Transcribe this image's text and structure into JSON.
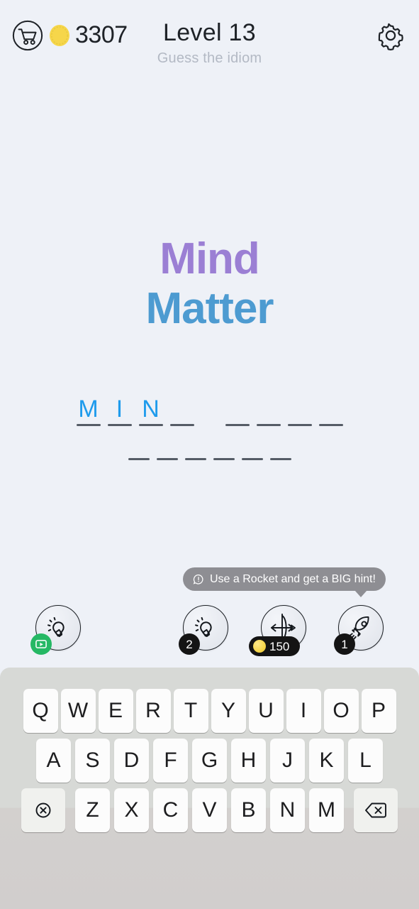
{
  "topbar": {
    "cart_icon": "shopping-cart-icon",
    "coin_icon": "coin-icon",
    "coin_count": "3307",
    "level_title": "Level 13",
    "level_subtitle": "Guess the idiom",
    "settings_icon": "gear-icon"
  },
  "rebus": {
    "line1": "Mind",
    "line2": "Matter",
    "line1_color": "#9b7fd4",
    "line2_color": "#4d9bd1"
  },
  "answer": {
    "row1": [
      {
        "word_index": 0,
        "letters": [
          "M",
          "I",
          "N",
          ""
        ]
      },
      {
        "word_index": 1,
        "letters": [
          "",
          "",
          "",
          ""
        ]
      }
    ],
    "row2": [
      {
        "word_index": 2,
        "letters": [
          "",
          "",
          "",
          "",
          "",
          ""
        ]
      }
    ],
    "filled_color": "#1e9bec"
  },
  "tooltip": {
    "icon": "exclamation-bubble-icon",
    "text": "Use a Rocket and get a BIG hint!"
  },
  "hints": [
    {
      "id": "hint-bulb-video",
      "icon": "lightbulb-icon",
      "badge_type": "video",
      "badge_icon": "play-video-icon",
      "badge_label": ""
    },
    {
      "id": "hint-bulb-count",
      "icon": "lightbulb-icon",
      "badge_type": "count",
      "badge_label": "2"
    },
    {
      "id": "hint-bow-arrow",
      "icon": "bow-and-arrow-icon",
      "badge_type": "price",
      "badge_label": "150",
      "badge_coin_icon": "coin-icon"
    },
    {
      "id": "hint-rocket",
      "icon": "rocket-icon",
      "badge_type": "count",
      "badge_label": "1"
    }
  ],
  "keyboard": {
    "row1": [
      "Q",
      "W",
      "E",
      "R",
      "T",
      "Y",
      "U",
      "I",
      "O",
      "P"
    ],
    "row2": [
      "A",
      "S",
      "D",
      "F",
      "G",
      "H",
      "J",
      "K",
      "L"
    ],
    "row3_letters": [
      "Z",
      "X",
      "C",
      "V",
      "B",
      "N",
      "M"
    ],
    "clear_key_icon": "circle-x-icon",
    "backspace_key_icon": "backspace-icon"
  },
  "colors": {
    "background": "#eef1f7",
    "keyboard_bg": "#d7d9d6",
    "key_bg": "#fcfcfc",
    "tooltip_bg": "#8e8e93",
    "badge_dark": "#141414",
    "badge_green": "#25b864",
    "coin_yellow": "#f6d64a"
  }
}
